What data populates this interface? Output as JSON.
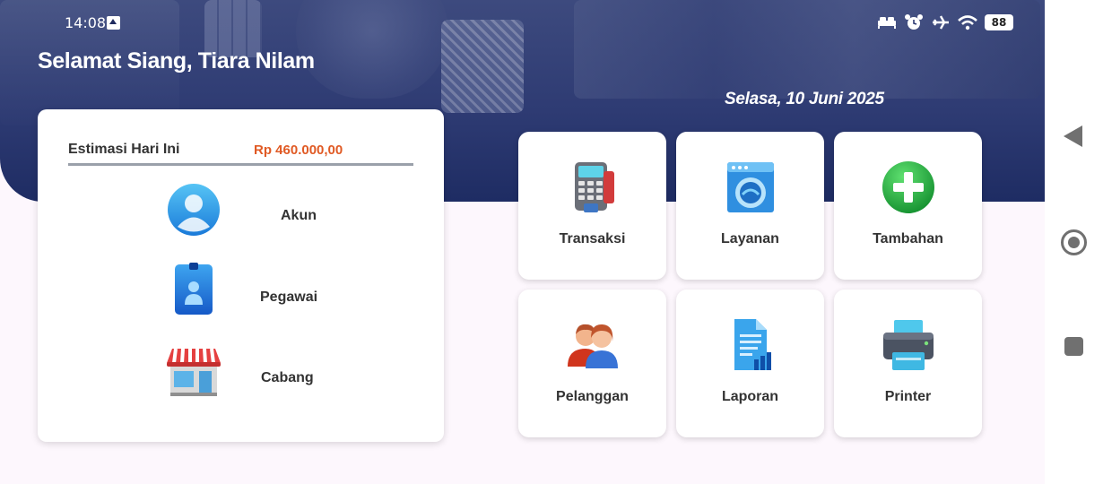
{
  "status_bar": {
    "time": "14:08",
    "battery": "88",
    "icons": [
      "upload-icon",
      "bed-icon",
      "alarm-icon",
      "airplane-icon",
      "wifi-icon",
      "battery-icon"
    ]
  },
  "header": {
    "greeting": "Selamat Siang, Tiara Nilam",
    "date": "Selasa, 10 Juni 2025"
  },
  "estimation": {
    "label": "Estimasi Hari Ini",
    "value": "Rp  460.000,00"
  },
  "left_menu": [
    {
      "label": "Akun",
      "icon": "account-icon"
    },
    {
      "label": "Pegawai",
      "icon": "employee-badge-icon"
    },
    {
      "label": "Cabang",
      "icon": "store-icon"
    }
  ],
  "tiles": [
    {
      "label": "Transaksi",
      "icon": "payment-terminal-icon"
    },
    {
      "label": "Layanan",
      "icon": "washing-machine-icon"
    },
    {
      "label": "Tambahan",
      "icon": "plus-icon"
    },
    {
      "label": "Pelanggan",
      "icon": "customers-icon"
    },
    {
      "label": "Laporan",
      "icon": "report-icon"
    },
    {
      "label": "Printer",
      "icon": "printer-icon"
    }
  ],
  "nav_bar": {
    "icons": [
      "back-icon",
      "home-icon",
      "recent-apps-icon"
    ]
  },
  "colors": {
    "header_bg": "#2e3b73",
    "accent_value": "#e05a24",
    "page_bg": "#fdf7fd"
  }
}
